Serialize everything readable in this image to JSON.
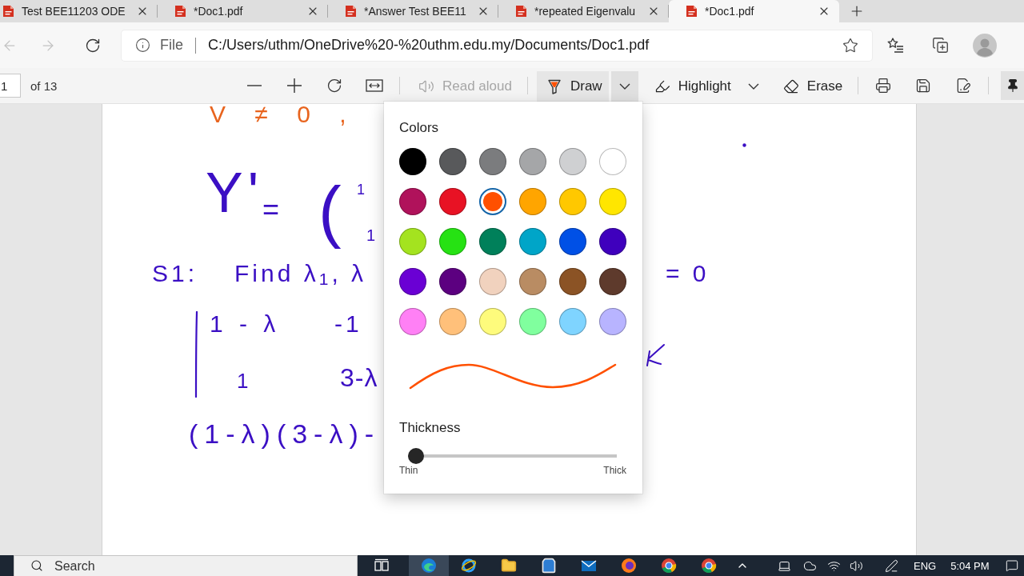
{
  "tabs": [
    {
      "title": "Test BEE11203 ODE",
      "selected": false
    },
    {
      "title": "*Doc1.pdf",
      "selected": false
    },
    {
      "title": "*Answer Test BEE11",
      "selected": false
    },
    {
      "title": "*repeated Eigenvalu",
      "selected": false
    },
    {
      "title": "*Doc1.pdf",
      "selected": true
    }
  ],
  "address_bar": {
    "back": {
      "disabled": true
    },
    "forward": {
      "disabled": true
    },
    "scheme": "File",
    "url": "C:/Users/uthm/OneDrive%20-%20uthm.edu.my/Documents/Doc1.pdf"
  },
  "pdf_toolbar": {
    "page_number": {
      "value": "1"
    },
    "page_count": "of 13",
    "tools": [
      {
        "label": "Read aloud",
        "disabled": true,
        "selected": false,
        "dropdown": false
      },
      {
        "label": "Draw",
        "disabled": false,
        "selected": true,
        "dropdown": true
      },
      {
        "label": "Highlight",
        "disabled": false,
        "selected": false,
        "dropdown": true
      },
      {
        "label": "Erase",
        "disabled": false,
        "selected": false,
        "dropdown": false
      }
    ]
  },
  "document": {
    "ink": [
      {
        "text": "V ≠ 0 ,",
        "color": "#e8641e"
      },
      {
        "text": "Y'",
        "color": "#3b0fc4"
      },
      {
        "text": "=",
        "color": "#3b0fc4"
      },
      {
        "text": "(",
        "color": "#3b0fc4"
      },
      {
        "text": "1",
        "color": "#3b0fc4"
      },
      {
        "text": "1",
        "color": "#3b0fc4"
      },
      {
        "text": "S1:",
        "color": "#3b0fc4"
      },
      {
        "text": "Find λ$_{1}$, λ",
        "color": "#3b0fc4"
      },
      {
        "text": "= 0",
        "color": "#3b0fc4"
      },
      {
        "text": "1 - λ",
        "color": "#3b0fc4"
      },
      {
        "text": "-1",
        "color": "#3b0fc4"
      },
      {
        "text": "1",
        "color": "#3b0fc4"
      },
      {
        "text": "3-λ",
        "color": "#3b0fc4"
      },
      {
        "text": "(1-λ)(3-λ)-",
        "color": "#3b0fc4"
      }
    ]
  },
  "draw_menu": {
    "title": "Colors",
    "swatches": [
      {
        "color": "#000000",
        "selected": false
      },
      {
        "color": "#58595b",
        "selected": false
      },
      {
        "color": "#7b7c7e",
        "selected": false
      },
      {
        "color": "#a5a6a8",
        "selected": false
      },
      {
        "color": "#cfd0d2",
        "selected": false
      },
      {
        "color": "#ffffff",
        "selected": false
      },
      {
        "color": "#b0125b",
        "selected": false
      },
      {
        "color": "#e81224",
        "selected": false
      },
      {
        "color": "#ff5000",
        "selected": true
      },
      {
        "color": "#ffa500",
        "selected": false
      },
      {
        "color": "#ffc800",
        "selected": false
      },
      {
        "color": "#ffe600",
        "selected": false
      },
      {
        "color": "#a4e31f",
        "selected": false
      },
      {
        "color": "#26e213",
        "selected": false
      },
      {
        "color": "#00805a",
        "selected": false
      },
      {
        "color": "#00a5c8",
        "selected": false
      },
      {
        "color": "#0050e6",
        "selected": false
      },
      {
        "color": "#3f00bd",
        "selected": false
      },
      {
        "color": "#6a00d4",
        "selected": false
      },
      {
        "color": "#5c0080",
        "selected": false
      },
      {
        "color": "#f1d2be",
        "selected": false
      },
      {
        "color": "#b98c63",
        "selected": false
      },
      {
        "color": "#8b5325",
        "selected": false
      },
      {
        "color": "#5e3a2c",
        "selected": false
      },
      {
        "color": "#ff80f5",
        "selected": false
      },
      {
        "color": "#ffc07a",
        "selected": false
      },
      {
        "color": "#fefb7c",
        "selected": false
      },
      {
        "color": "#80ff9e",
        "selected": false
      },
      {
        "color": "#7fd4ff",
        "selected": false
      },
      {
        "color": "#b8b4ff",
        "selected": false
      }
    ],
    "thickness": {
      "label": "Thickness",
      "level": 0,
      "min_label": "Thin",
      "max_label": "Thick"
    }
  },
  "taskbar": {
    "search": {
      "placeholder": "Search"
    },
    "language": "ENG",
    "time": "5:04 PM"
  }
}
